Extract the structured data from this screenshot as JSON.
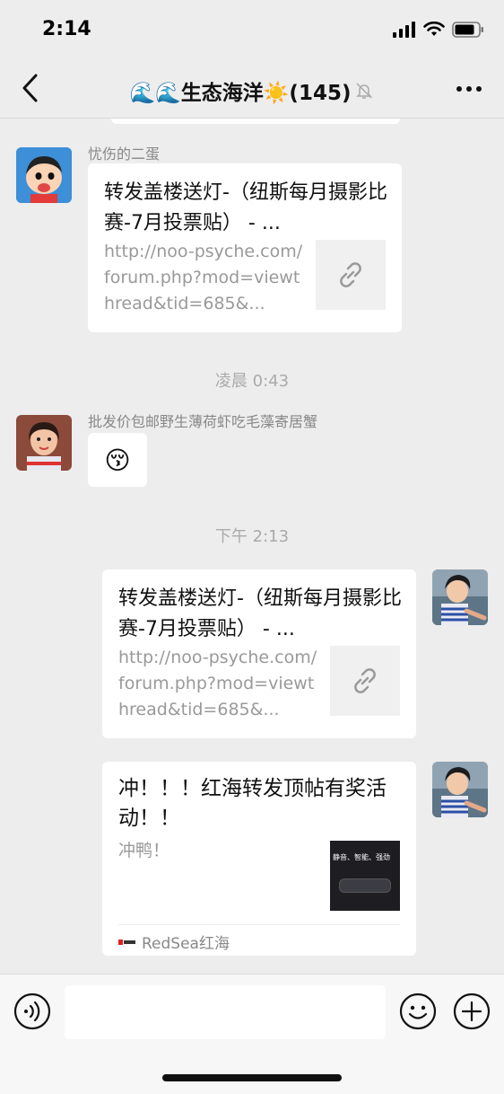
{
  "status": {
    "time": "2:14"
  },
  "nav": {
    "title": "🌊🌊生态海洋☀️(145)"
  },
  "messages": [
    {
      "sender": "忧伤的二蛋",
      "link_title": "转发盖楼送灯-（纽斯每月摄影比赛-7月投票贴） - ...",
      "link_url": "http://noo-psyche.com/forum.php?mod=viewthread&tid=685&..."
    },
    {
      "time": "凌晨 0:43",
      "sender": "批发价包邮野生薄荷虾吃毛藻寄居蟹",
      "emoji": "😚"
    },
    {
      "time": "下午 2:13",
      "link_title": "转发盖楼送灯-（纽斯每月摄影比赛-7月投票贴） - ...",
      "link_url": "http://noo-psyche.com/forum.php?mod=viewthread&tid=685&..."
    },
    {
      "link_title": "冲！！！红海转发顶帖有奖活动！！",
      "desc": "冲鸭！",
      "thumb_text": "静音、智能、强劲",
      "source": "RedSea红海"
    }
  ],
  "colors": {
    "background": "#ededed",
    "bubble": "#ffffff",
    "meta": "#999999"
  }
}
